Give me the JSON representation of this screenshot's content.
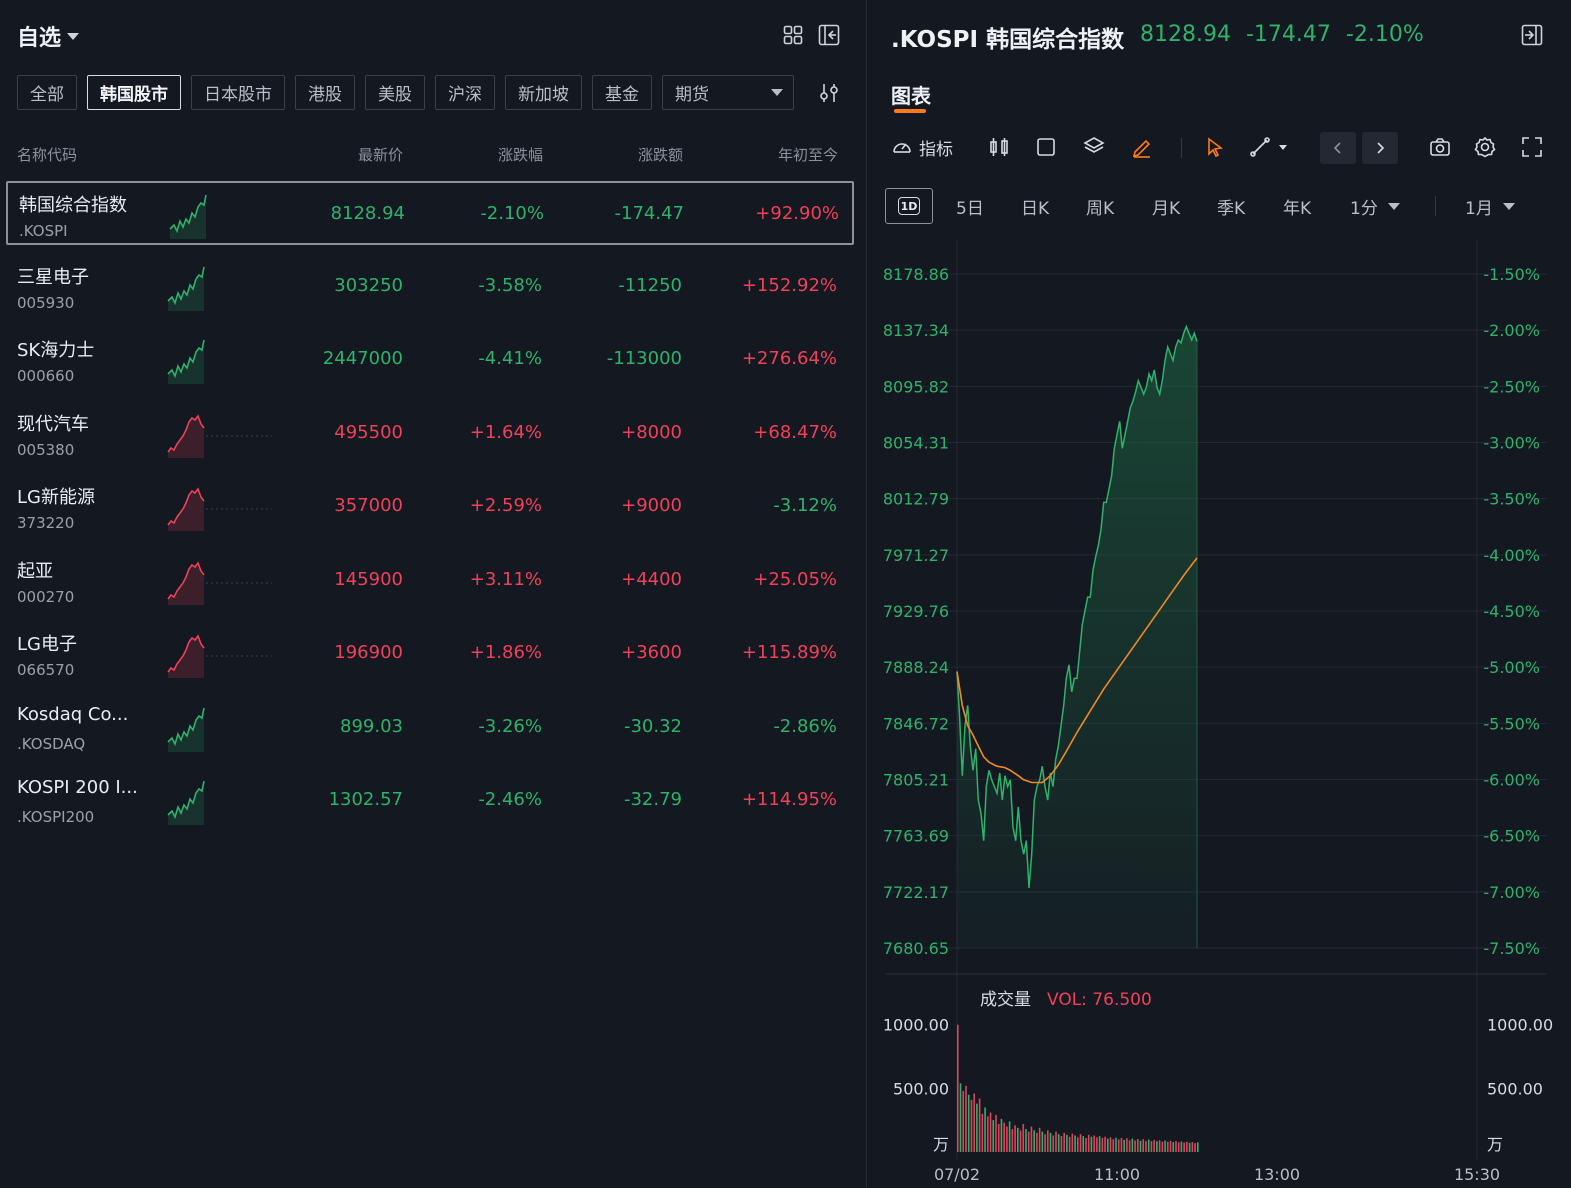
{
  "watchlist": {
    "title": "自选",
    "tabs": [
      "全部",
      "韩国股市",
      "日本股市",
      "港股",
      "美股",
      "沪深",
      "新加坡",
      "基金"
    ],
    "futures_select": "期货",
    "columns": {
      "name": "名称代码",
      "price": "最新价",
      "change_pct": "涨跌幅",
      "change_amt": "涨跌额",
      "ytd": "年初至今"
    },
    "rows": [
      {
        "name": "韩国综合指数",
        "code": ".KOSPI",
        "price": "8128.94",
        "pct": "-2.10%",
        "amt": "-174.47",
        "ytd": "+92.90%",
        "dir": "down",
        "ytd_dir": "up"
      },
      {
        "name": "三星电子",
        "code": "005930",
        "price": "303250",
        "pct": "-3.58%",
        "amt": "-11250",
        "ytd": "+152.92%",
        "dir": "down",
        "ytd_dir": "up"
      },
      {
        "name": "SK海力士",
        "code": "000660",
        "price": "2447000",
        "pct": "-4.41%",
        "amt": "-113000",
        "ytd": "+276.64%",
        "dir": "down",
        "ytd_dir": "up"
      },
      {
        "name": "现代汽车",
        "code": "005380",
        "price": "495500",
        "pct": "+1.64%",
        "amt": "+8000",
        "ytd": "+68.47%",
        "dir": "up",
        "ytd_dir": "up"
      },
      {
        "name": "LG新能源",
        "code": "373220",
        "price": "357000",
        "pct": "+2.59%",
        "amt": "+9000",
        "ytd": "-3.12%",
        "dir": "up",
        "ytd_dir": "down"
      },
      {
        "name": "起亚",
        "code": "000270",
        "price": "145900",
        "pct": "+3.11%",
        "amt": "+4400",
        "ytd": "+25.05%",
        "dir": "up",
        "ytd_dir": "up"
      },
      {
        "name": "LG电子",
        "code": "066570",
        "price": "196900",
        "pct": "+1.86%",
        "amt": "+3600",
        "ytd": "+115.89%",
        "dir": "up",
        "ytd_dir": "up"
      },
      {
        "name": "Kosdaq Co...",
        "code": ".KOSDAQ",
        "price": "899.03",
        "pct": "-3.26%",
        "amt": "-30.32",
        "ytd": "-2.86%",
        "dir": "down",
        "ytd_dir": "down"
      },
      {
        "name": "KOSPI 200 I...",
        "code": ".KOSPI200",
        "price": "1302.57",
        "pct": "-2.46%",
        "amt": "-32.79",
        "ytd": "+114.95%",
        "dir": "down",
        "ytd_dir": "up"
      }
    ]
  },
  "detail": {
    "title": ".KOSPI 韩国综合指数",
    "price": "8128.94",
    "change": "-174.47",
    "change_pct": "-2.10%",
    "chart_tab": "图表",
    "indicator_label": "指标",
    "periods": [
      "5日",
      "日K",
      "周K",
      "月K",
      "季K",
      "年K"
    ],
    "period_active": "1D",
    "interval_select": "1分",
    "range_select": "1月",
    "volume_label": "成交量",
    "volume_value": "VOL: 76.500",
    "volume_unit": "万"
  },
  "colors": {
    "up": "#f04158",
    "down": "#2fb26a",
    "avg_line": "#f08a24",
    "accent": "#ff7a1a"
  },
  "icons": [
    "grid-icon",
    "collapse-left-icon",
    "sliders-icon",
    "speedometer-icon",
    "candlestick-icon",
    "rectangle-icon",
    "layers-icon",
    "pencil-icon",
    "cursor-icon",
    "line-tool-icon",
    "camera-icon",
    "gear-icon",
    "fullscreen-icon",
    "exit-panel-icon"
  ],
  "chart_data": {
    "type": "line",
    "x_ticks": [
      "07/02",
      "11:00",
      "13:00",
      "15:30"
    ],
    "y_ticks": [
      "8178.86",
      "8137.34",
      "8095.82",
      "8054.31",
      "8012.79",
      "7971.27",
      "7929.76",
      "7888.24",
      "7846.72",
      "7805.21",
      "7763.69",
      "7722.17",
      "7680.65"
    ],
    "y_pct_ticks": [
      "-1.50%",
      "-2.00%",
      "-2.50%",
      "-3.00%",
      "-3.50%",
      "-4.00%",
      "-4.50%",
      "-5.00%",
      "-5.50%",
      "-6.00%",
      "-6.50%",
      "-7.00%",
      "-7.50%"
    ],
    "ylim": [
      7680.65,
      8178.86
    ],
    "session_minutes": 390,
    "series": [
      {
        "color": "#2fb26a",
        "points": [
          [
            0,
            7885
          ],
          [
            2,
            7850
          ],
          [
            4,
            7808
          ],
          [
            6,
            7845
          ],
          [
            8,
            7860
          ],
          [
            10,
            7830
          ],
          [
            12,
            7812
          ],
          [
            14,
            7828
          ],
          [
            16,
            7790
          ],
          [
            18,
            7780
          ],
          [
            20,
            7760
          ],
          [
            22,
            7800
          ],
          [
            24,
            7812
          ],
          [
            26,
            7805
          ],
          [
            28,
            7800
          ],
          [
            30,
            7795
          ],
          [
            32,
            7810
          ],
          [
            34,
            7790
          ],
          [
            36,
            7808
          ],
          [
            38,
            7800
          ],
          [
            40,
            7805
          ],
          [
            42,
            7770
          ],
          [
            44,
            7760
          ],
          [
            46,
            7785
          ],
          [
            48,
            7760
          ],
          [
            50,
            7750
          ],
          [
            52,
            7760
          ],
          [
            54,
            7725
          ],
          [
            56,
            7750
          ],
          [
            58,
            7790
          ],
          [
            60,
            7800
          ],
          [
            62,
            7805
          ],
          [
            64,
            7815
          ],
          [
            66,
            7800
          ],
          [
            68,
            7790
          ],
          [
            70,
            7810
          ],
          [
            72,
            7800
          ],
          [
            74,
            7820
          ],
          [
            76,
            7830
          ],
          [
            78,
            7845
          ],
          [
            80,
            7860
          ],
          [
            82,
            7880
          ],
          [
            84,
            7890
          ],
          [
            86,
            7870
          ],
          [
            88,
            7880
          ],
          [
            90,
            7880
          ],
          [
            92,
            7900
          ],
          [
            94,
            7920
          ],
          [
            96,
            7930
          ],
          [
            98,
            7940
          ],
          [
            100,
            7940
          ],
          [
            102,
            7960
          ],
          [
            104,
            7970
          ],
          [
            106,
            7978
          ],
          [
            108,
            7990
          ],
          [
            110,
            8010
          ],
          [
            112,
            8010
          ],
          [
            114,
            8020
          ],
          [
            116,
            8030
          ],
          [
            118,
            8050
          ],
          [
            120,
            8060
          ],
          [
            122,
            8070
          ],
          [
            124,
            8050
          ],
          [
            126,
            8060
          ],
          [
            128,
            8070
          ],
          [
            130,
            8080
          ],
          [
            132,
            8085
          ],
          [
            134,
            8092
          ],
          [
            136,
            8100
          ],
          [
            138,
            8095
          ],
          [
            140,
            8090
          ],
          [
            142,
            8095
          ],
          [
            144,
            8105
          ],
          [
            146,
            8100
          ],
          [
            148,
            8108
          ],
          [
            150,
            8095
          ],
          [
            152,
            8090
          ],
          [
            154,
            8100
          ],
          [
            156,
            8115
          ],
          [
            158,
            8125
          ],
          [
            160,
            8120
          ],
          [
            162,
            8115
          ],
          [
            164,
            8125
          ],
          [
            166,
            8130
          ],
          [
            168,
            8128
          ],
          [
            170,
            8135
          ],
          [
            172,
            8140
          ],
          [
            174,
            8135
          ],
          [
            176,
            8130
          ],
          [
            178,
            8135
          ],
          [
            180,
            8128.94
          ]
        ]
      },
      {
        "color": "#f08a24",
        "points": [
          [
            0,
            7885
          ],
          [
            4,
            7860
          ],
          [
            8,
            7845
          ],
          [
            12,
            7838
          ],
          [
            16,
            7830
          ],
          [
            20,
            7822
          ],
          [
            24,
            7818
          ],
          [
            30,
            7815
          ],
          [
            36,
            7814
          ],
          [
            40,
            7812
          ],
          [
            46,
            7808
          ],
          [
            50,
            7805
          ],
          [
            56,
            7803
          ],
          [
            64,
            7803
          ],
          [
            70,
            7808
          ],
          [
            76,
            7816
          ],
          [
            82,
            7826
          ],
          [
            90,
            7840
          ],
          [
            100,
            7856
          ],
          [
            110,
            7872
          ],
          [
            120,
            7886
          ],
          [
            130,
            7900
          ],
          [
            140,
            7914
          ],
          [
            150,
            7928
          ],
          [
            160,
            7942
          ],
          [
            170,
            7956
          ],
          [
            180,
            7969
          ]
        ]
      }
    ],
    "volume": {
      "ylim_ticks": [
        "1000.00",
        "500.00"
      ],
      "unit": "万",
      "bars": [
        1000,
        540,
        480,
        520,
        450,
        410,
        460,
        380,
        420,
        300,
        350,
        280,
        310,
        250,
        290,
        220,
        260,
        230,
        200,
        240,
        180,
        210,
        190,
        170,
        220,
        180,
        160,
        200,
        170,
        150,
        190,
        160,
        140,
        170,
        150,
        130,
        160,
        140,
        125,
        150,
        135,
        120,
        145,
        130,
        115,
        140,
        125,
        110,
        135,
        120,
        130,
        115,
        125,
        110,
        120,
        105,
        115,
        100,
        112,
        98,
        110,
        95,
        108,
        92,
        105,
        90,
        102,
        88,
        100,
        86,
        98,
        85,
        95,
        84,
        92,
        82,
        90,
        80,
        88,
        78,
        85,
        76,
        82,
        74,
        80,
        72,
        78,
        70,
        76.5
      ]
    }
  }
}
